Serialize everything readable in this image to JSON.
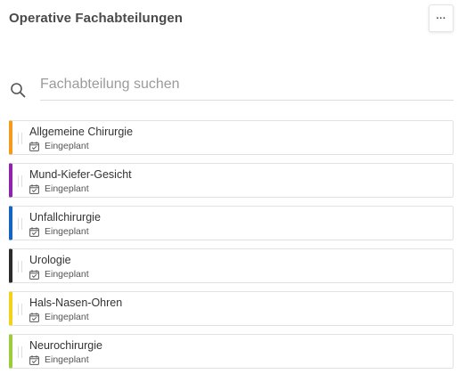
{
  "header": {
    "title": "Operative Fachabteilungen",
    "more_label": "···",
    "more_icon": "more-horizontal-icon"
  },
  "search": {
    "placeholder": "Fachabteilung suchen",
    "value": "",
    "icon": "search-icon"
  },
  "departments": [
    {
      "name": "Allgemeine Chirurgie",
      "status": "Eingeplant",
      "color": "#f29b1d"
    },
    {
      "name": "Mund-Kiefer-Gesicht",
      "status": "Eingeplant",
      "color": "#8e24aa"
    },
    {
      "name": "Unfallchirurgie",
      "status": "Eingeplant",
      "color": "#1565c0"
    },
    {
      "name": "Urologie",
      "status": "Eingeplant",
      "color": "#2b2b2b"
    },
    {
      "name": "Hals-Nasen-Ohren",
      "status": "Eingeplant",
      "color": "#f2d21b"
    },
    {
      "name": "Neurochirurgie",
      "status": "Eingeplant",
      "color": "#9ccc3c"
    }
  ]
}
